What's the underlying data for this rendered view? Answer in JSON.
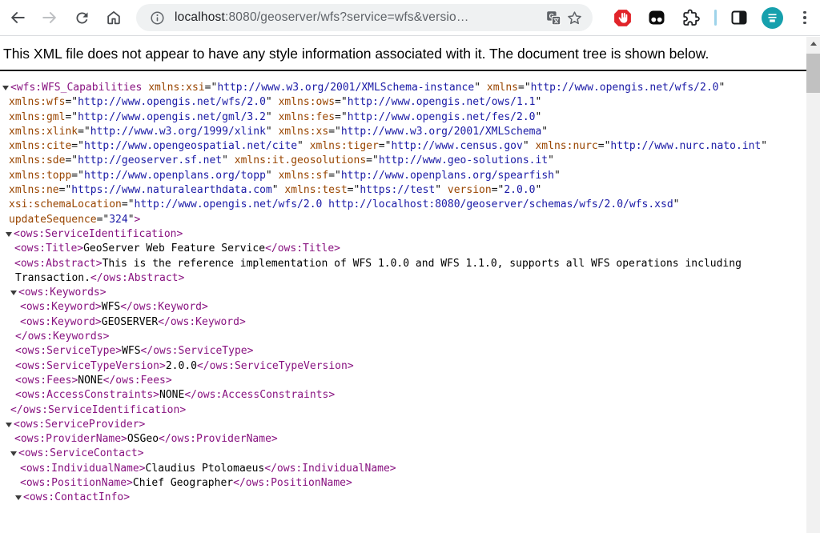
{
  "toolbar": {
    "url": {
      "host": "localhost",
      "rest": ":8080/geoserver/wfs?service=wfs&versio…"
    },
    "icons": {
      "back": "arrow-left",
      "forward": "arrow-right",
      "reload": "refresh-arrow",
      "home": "house",
      "page_info": "info-circle",
      "translate": "google-translate",
      "bookmark": "star-outline",
      "adblock": "red-octagon-hand",
      "dark_extension": "black-square-two-dots",
      "extensions": "puzzle-piece",
      "separator": "blue-bar",
      "side_panel": "split-square",
      "profile": "teal-avatar",
      "menu": "three-dots-vertical"
    },
    "colors": {
      "adblock_red": "#e1242a",
      "avatar_teal": "#16a0ad",
      "separator_blue": "#9ed3ea",
      "icon_gray": "#5f6368",
      "icon_dark": "#494c50"
    }
  },
  "notice": {
    "text": "This XML file does not appear to have any style information associated with it. The document tree is shown below."
  },
  "scrollbar": {
    "up_icon": "triangle-up"
  },
  "xml": {
    "colors": {
      "tag": "#881280",
      "attr": "#994500",
      "value": "#1a1aa6",
      "text": "#000000",
      "arrow": "#3c3c3c"
    },
    "lines": [
      {
        "pad": 3,
        "arrow": true,
        "s": [
          [
            "t",
            "<wfs:WFS_Capabilities"
          ],
          [
            "q",
            " "
          ],
          [
            "a",
            "xmlns:xsi"
          ],
          [
            "q",
            "=\""
          ],
          [
            "v",
            "http://www.w3.org/2001/XMLSchema-instance"
          ],
          [
            "q",
            "\" "
          ],
          [
            "a",
            "xmlns"
          ],
          [
            "q",
            "=\""
          ],
          [
            "v",
            "http://www.opengis.net/wfs/2.0"
          ],
          [
            "q",
            "\""
          ]
        ]
      },
      {
        "pad": 11,
        "arrow": false,
        "s": [
          [
            "a",
            "xmlns:wfs"
          ],
          [
            "q",
            "=\""
          ],
          [
            "v",
            "http://www.opengis.net/wfs/2.0"
          ],
          [
            "q",
            "\" "
          ],
          [
            "a",
            "xmlns:ows"
          ],
          [
            "q",
            "=\""
          ],
          [
            "v",
            "http://www.opengis.net/ows/1.1"
          ],
          [
            "q",
            "\""
          ]
        ]
      },
      {
        "pad": 11,
        "arrow": false,
        "s": [
          [
            "a",
            "xmlns:gml"
          ],
          [
            "q",
            "=\""
          ],
          [
            "v",
            "http://www.opengis.net/gml/3.2"
          ],
          [
            "q",
            "\" "
          ],
          [
            "a",
            "xmlns:fes"
          ],
          [
            "q",
            "=\""
          ],
          [
            "v",
            "http://www.opengis.net/fes/2.0"
          ],
          [
            "q",
            "\""
          ]
        ]
      },
      {
        "pad": 11,
        "arrow": false,
        "s": [
          [
            "a",
            "xmlns:xlink"
          ],
          [
            "q",
            "=\""
          ],
          [
            "v",
            "http://www.w3.org/1999/xlink"
          ],
          [
            "q",
            "\" "
          ],
          [
            "a",
            "xmlns:xs"
          ],
          [
            "q",
            "=\""
          ],
          [
            "v",
            "http://www.w3.org/2001/XMLSchema"
          ],
          [
            "q",
            "\""
          ]
        ]
      },
      {
        "pad": 11,
        "arrow": false,
        "s": [
          [
            "a",
            "xmlns:cite"
          ],
          [
            "q",
            "=\""
          ],
          [
            "v",
            "http://www.opengeospatial.net/cite"
          ],
          [
            "q",
            "\" "
          ],
          [
            "a",
            "xmlns:tiger"
          ],
          [
            "q",
            "=\""
          ],
          [
            "v",
            "http://www.census.gov"
          ],
          [
            "q",
            "\" "
          ],
          [
            "a",
            "xmlns:nurc"
          ],
          [
            "q",
            "=\""
          ],
          [
            "v",
            "http://www.nurc.nato.int"
          ],
          [
            "q",
            "\""
          ]
        ]
      },
      {
        "pad": 11,
        "arrow": false,
        "s": [
          [
            "a",
            "xmlns:sde"
          ],
          [
            "q",
            "=\""
          ],
          [
            "v",
            "http://geoserver.sf.net"
          ],
          [
            "q",
            "\" "
          ],
          [
            "a",
            "xmlns:it.geosolutions"
          ],
          [
            "q",
            "=\""
          ],
          [
            "v",
            "http://www.geo-solutions.it"
          ],
          [
            "q",
            "\""
          ]
        ]
      },
      {
        "pad": 11,
        "arrow": false,
        "s": [
          [
            "a",
            "xmlns:topp"
          ],
          [
            "q",
            "=\""
          ],
          [
            "v",
            "http://www.openplans.org/topp"
          ],
          [
            "q",
            "\" "
          ],
          [
            "a",
            "xmlns:sf"
          ],
          [
            "q",
            "=\""
          ],
          [
            "v",
            "http://www.openplans.org/spearfish"
          ],
          [
            "q",
            "\""
          ]
        ]
      },
      {
        "pad": 11,
        "arrow": false,
        "s": [
          [
            "a",
            "xmlns:ne"
          ],
          [
            "q",
            "=\""
          ],
          [
            "v",
            "https://www.naturalearthdata.com"
          ],
          [
            "q",
            "\" "
          ],
          [
            "a",
            "xmlns:test"
          ],
          [
            "q",
            "=\""
          ],
          [
            "v",
            "https://test"
          ],
          [
            "q",
            "\" "
          ],
          [
            "a",
            "version"
          ],
          [
            "q",
            "=\""
          ],
          [
            "v",
            "2.0.0"
          ],
          [
            "q",
            "\""
          ]
        ]
      },
      {
        "pad": 11,
        "arrow": false,
        "s": [
          [
            "a",
            "xsi:schemaLocation"
          ],
          [
            "q",
            "=\""
          ],
          [
            "v",
            "http://www.opengis.net/wfs/2.0 http://localhost:8080/geoserver/schemas/wfs/2.0/wfs.xsd"
          ],
          [
            "q",
            "\""
          ]
        ]
      },
      {
        "pad": 11,
        "arrow": false,
        "s": [
          [
            "a",
            "updateSequence"
          ],
          [
            "q",
            "=\""
          ],
          [
            "v",
            "324"
          ],
          [
            "q",
            "\""
          ],
          [
            "t",
            ">"
          ]
        ]
      },
      {
        "pad": 7,
        "arrow": true,
        "s": [
          [
            "t",
            "<ows:ServiceIdentification>"
          ]
        ]
      },
      {
        "pad": 18,
        "arrow": false,
        "s": [
          [
            "t",
            "<ows:Title>"
          ],
          [
            "x",
            "GeoServer Web Feature Service"
          ],
          [
            "t",
            "</ows:Title>"
          ]
        ]
      },
      {
        "pad": 18,
        "arrow": false,
        "s": [
          [
            "t",
            "<ows:Abstract>"
          ],
          [
            "x",
            "This is the reference implementation of WFS 1.0.0 and WFS 1.1.0, supports all WFS operations including"
          ]
        ]
      },
      {
        "pad": 19,
        "arrow": false,
        "s": [
          [
            "x",
            "Transaction."
          ],
          [
            "t",
            "</ows:Abstract>"
          ]
        ]
      },
      {
        "pad": 13,
        "arrow": true,
        "s": [
          [
            "t",
            "<ows:Keywords>"
          ]
        ]
      },
      {
        "pad": 25,
        "arrow": false,
        "s": [
          [
            "t",
            "<ows:Keyword>"
          ],
          [
            "x",
            "WFS"
          ],
          [
            "t",
            "</ows:Keyword>"
          ]
        ]
      },
      {
        "pad": 25,
        "arrow": false,
        "s": [
          [
            "t",
            "<ows:Keyword>"
          ],
          [
            "x",
            "GEOSERVER"
          ],
          [
            "t",
            "</ows:Keyword>"
          ]
        ]
      },
      {
        "pad": 19,
        "arrow": false,
        "s": [
          [
            "t",
            "</ows:Keywords>"
          ]
        ]
      },
      {
        "pad": 19,
        "arrow": false,
        "s": [
          [
            "t",
            "<ows:ServiceType>"
          ],
          [
            "x",
            "WFS"
          ],
          [
            "t",
            "</ows:ServiceType>"
          ]
        ]
      },
      {
        "pad": 19,
        "arrow": false,
        "s": [
          [
            "t",
            "<ows:ServiceTypeVersion>"
          ],
          [
            "x",
            "2.0.0"
          ],
          [
            "t",
            "</ows:ServiceTypeVersion>"
          ]
        ]
      },
      {
        "pad": 19,
        "arrow": false,
        "s": [
          [
            "t",
            "<ows:Fees>"
          ],
          [
            "x",
            "NONE"
          ],
          [
            "t",
            "</ows:Fees>"
          ]
        ]
      },
      {
        "pad": 19,
        "arrow": false,
        "s": [
          [
            "t",
            "<ows:AccessConstraints>"
          ],
          [
            "x",
            "NONE"
          ],
          [
            "t",
            "</ows:AccessConstraints>"
          ]
        ]
      },
      {
        "pad": 13,
        "arrow": false,
        "s": [
          [
            "t",
            "</ows:ServiceIdentification>"
          ]
        ]
      },
      {
        "pad": 7,
        "arrow": true,
        "s": [
          [
            "t",
            "<ows:ServiceProvider>"
          ]
        ]
      },
      {
        "pad": 18,
        "arrow": false,
        "s": [
          [
            "t",
            "<ows:ProviderName>"
          ],
          [
            "x",
            "OSGeo"
          ],
          [
            "t",
            "</ows:ProviderName>"
          ]
        ]
      },
      {
        "pad": 13,
        "arrow": true,
        "s": [
          [
            "t",
            "<ows:ServiceContact>"
          ]
        ]
      },
      {
        "pad": 25,
        "arrow": false,
        "s": [
          [
            "t",
            "<ows:IndividualName>"
          ],
          [
            "x",
            "Claudius Ptolomaeus"
          ],
          [
            "t",
            "</ows:IndividualName>"
          ]
        ]
      },
      {
        "pad": 25,
        "arrow": false,
        "s": [
          [
            "t",
            "<ows:PositionName>"
          ],
          [
            "x",
            "Chief Geographer"
          ],
          [
            "t",
            "</ows:PositionName>"
          ]
        ]
      },
      {
        "pad": 19,
        "arrow": true,
        "s": [
          [
            "t",
            "<ows:ContactInfo>"
          ]
        ]
      }
    ]
  }
}
